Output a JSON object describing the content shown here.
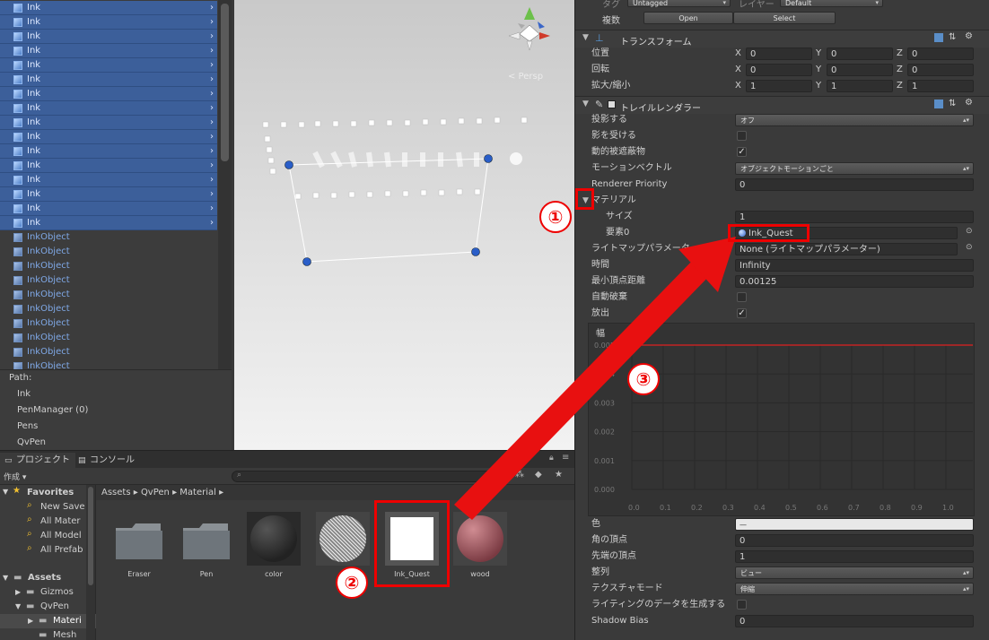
{
  "hierarchy": {
    "ink_items": [
      "Ink",
      "Ink",
      "Ink",
      "Ink",
      "Ink",
      "Ink",
      "Ink",
      "Ink",
      "Ink",
      "Ink",
      "Ink",
      "Ink",
      "Ink",
      "Ink",
      "Ink",
      "Ink"
    ],
    "object_items": [
      "InkObject",
      "InkObject",
      "InkObject",
      "InkObject",
      "InkObject",
      "InkObject",
      "InkObject",
      "InkObject",
      "InkObject",
      "InkObject"
    ]
  },
  "path_panel": {
    "title": "Path:",
    "lines": [
      "Ink",
      "PenManager (0)",
      "Pens",
      "QvPen"
    ]
  },
  "scene": {
    "persp_label": "< Persp"
  },
  "inspector": {
    "tag_label": "タグ",
    "tag_value": "Untagged",
    "layer_label": "レイヤー",
    "layer_value": "Default",
    "multi_label": "複数",
    "open_button": "Open",
    "select_button": "Select",
    "transform": {
      "title": "トランスフォーム",
      "rows": [
        {
          "label": "位置",
          "x": "0",
          "y": "0",
          "z": "0"
        },
        {
          "label": "回転",
          "x": "0",
          "y": "0",
          "z": "0"
        },
        {
          "label": "拡大/縮小",
          "x": "1",
          "y": "1",
          "z": "1"
        }
      ],
      "axis_x": "X",
      "axis_y": "Y",
      "axis_z": "Z"
    },
    "trail": {
      "title": "トレイルレンダラー",
      "cast_shadows_label": "投影する",
      "cast_shadows_value": "オフ",
      "receive_shadows_label": "影を受ける",
      "dynamic_occluded_label": "動的被遮蔽物",
      "motion_vectors_label": "モーションベクトル",
      "motion_vectors_value": "オブジェクトモーションごと",
      "renderer_priority_label": "Renderer Priority",
      "renderer_priority_value": "0",
      "materials_label": "マテリアル",
      "size_label": "サイズ",
      "size_value": "1",
      "element0_label": "要素0",
      "element0_value": "Ink_Quest",
      "lightmap_label": "ライトマップパラメーター",
      "lightmap_value": "None (ライトマップパラメーター)",
      "time_label": "時間",
      "time_value": "Infinity",
      "min_vertex_label": "最小頂点距離",
      "min_vertex_value": "0.00125",
      "autodestruct_label": "自動破棄",
      "emitting_label": "放出",
      "width_label": "幅",
      "color_label": "色",
      "color_value": "—",
      "corner_vertices_label": "角の頂点",
      "corner_vertices_value": "0",
      "end_cap_label": "先端の頂点",
      "end_cap_value": "1",
      "alignment_label": "整列",
      "alignment_value": "ビュー",
      "texture_mode_label": "テクスチャモード",
      "texture_mode_value": "伸縮",
      "lighting_data_label": "ライティングのデータを生成する",
      "shadow_bias_label": "Shadow Bias",
      "shadow_bias_value": "0"
    }
  },
  "chart_data": {
    "type": "line",
    "x_ticks": [
      "0.0",
      "0.1",
      "0.2",
      "0.3",
      "0.4",
      "0.5",
      "0.6",
      "0.7",
      "0.8",
      "0.9",
      "1.0"
    ],
    "y_ticks": [
      "0.005",
      "0.004",
      "0.003",
      "0.002",
      "0.001",
      "0.000"
    ],
    "x": [
      0.0,
      1.0
    ],
    "y": [
      0.005,
      0.005
    ],
    "xlim": [
      0.0,
      1.0
    ],
    "ylim": [
      0.0,
      0.005
    ],
    "line_color": "#e02020"
  },
  "project": {
    "tab_project": "プロジェクト",
    "tab_console": "コンソール",
    "create_label": "作成",
    "favorites_label": "Favorites",
    "favorites": [
      "New Save",
      "All Mater",
      "All Model",
      "All Prefab"
    ],
    "assets_label": "Assets",
    "asset_tree": [
      "Gizmos",
      "QvPen",
      "Materi",
      "Mesh"
    ],
    "breadcrumb": [
      "Assets",
      "QvPen",
      "Material"
    ],
    "assets": [
      "Eraser",
      "Pen",
      "color",
      "",
      "Ink_Quest",
      "wood"
    ]
  },
  "annotations": {
    "one": "①",
    "two": "②",
    "three": "③"
  },
  "colors": {
    "selection": "#3c5f9a",
    "annotation": "#e00000"
  }
}
